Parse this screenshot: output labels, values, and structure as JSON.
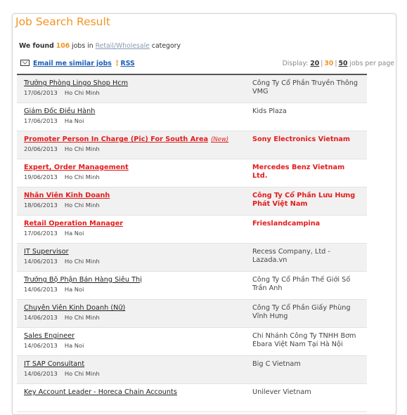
{
  "page_title": "Job Search Result",
  "summary": {
    "prefix": "We found",
    "count": "106",
    "middle": "jobs in",
    "category": "Retail/Wholesale",
    "suffix": "category"
  },
  "tools": {
    "email_label": "Email me similar jobs",
    "rss_label": "RSS"
  },
  "display": {
    "label": "Display:",
    "options": [
      "20",
      "30",
      "50"
    ],
    "selected": "30",
    "suffix": "jobs per page"
  },
  "jobs": [
    {
      "title": "Trưởng Phòng Lingo Shop  Hcm",
      "date": "17/06/2013",
      "city": "Ho Chi Minh",
      "company": "Công Ty Cổ Phần Truyền Thông VMG",
      "highlight": false,
      "new": ""
    },
    {
      "title": "Giám Đốc Điều Hành",
      "date": "17/06/2013",
      "city": "Ha Noi",
      "company": "Kids Plaza",
      "highlight": false,
      "new": ""
    },
    {
      "title": "Promoter Person In Charge (Pic) For South Area",
      "date": "20/06/2013",
      "city": "Ho Chi Minh",
      "company": "Sony Electronics Vietnam",
      "highlight": true,
      "new": "(New)"
    },
    {
      "title": "Expert, Order Management",
      "date": "19/06/2013",
      "city": "Ho Chi Minh",
      "company": "Mercedes Benz Vietnam Ltd.",
      "highlight": true,
      "new": ""
    },
    {
      "title": "Nhân Viên Kinh Doanh",
      "date": "18/06/2013",
      "city": "Ho Chi Minh",
      "company": "Công Ty Cổ Phần Lưu Hưng Phát Việt Nam",
      "highlight": true,
      "new": ""
    },
    {
      "title": "Retail Operation Manager",
      "date": "17/06/2013",
      "city": "Ha Noi",
      "company": "Frieslandcampina",
      "highlight": true,
      "new": ""
    },
    {
      "title": "IT Supervisor",
      "date": "14/06/2013",
      "city": "Ho Chi Minh",
      "company": "Recess Company, Ltd - Lazada.vn",
      "highlight": false,
      "new": ""
    },
    {
      "title": "Trưởng Bộ Phận Bán Hàng Siêu Thị",
      "date": "14/06/2013",
      "city": "Ha Noi",
      "company": "Công Ty Cổ Phần Thế Giới Số Trần Anh",
      "highlight": false,
      "new": ""
    },
    {
      "title": "Chuyên Viên Kinh Doanh (Nữ)",
      "date": "14/06/2013",
      "city": "Ho Chi Minh",
      "company": "Công Ty Cổ Phần Giấy Phùng Vĩnh Hưng",
      "highlight": false,
      "new": ""
    },
    {
      "title": "Sales Engineer",
      "date": "14/06/2013",
      "city": "Ha Noi",
      "company": "Chi Nhánh Công Ty TNHH Bơm Ebara Việt Nam Tại Hà Nội",
      "highlight": false,
      "new": ""
    },
    {
      "title": "IT SAP Consultant",
      "date": "14/06/2013",
      "city": "Ho Chi Minh",
      "company": "Big C Vietnam",
      "highlight": false,
      "new": ""
    },
    {
      "title": "Key Account Leader - Horeca Chain Accounts",
      "date": "",
      "city": "",
      "company": "Unilever Vietnam",
      "highlight": false,
      "new": ""
    }
  ]
}
